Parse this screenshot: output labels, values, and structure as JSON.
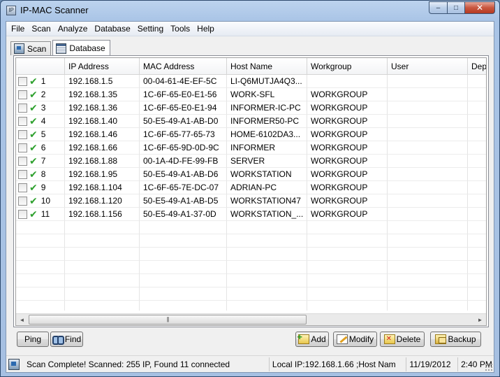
{
  "window": {
    "title": "IP-MAC Scanner",
    "minimize": "‒",
    "maximize": "□",
    "close": "✕"
  },
  "menu": [
    "File",
    "Scan",
    "Analyze",
    "Database",
    "Setting",
    "Tools",
    "Help"
  ],
  "tabs": [
    {
      "label": "Scan",
      "active": false
    },
    {
      "label": "Database",
      "active": true
    }
  ],
  "table": {
    "columns": [
      "",
      "IP Address",
      "MAC Address",
      "Host Name",
      "Workgroup",
      "User",
      "Dep"
    ],
    "rows": [
      {
        "id": "1",
        "ip": "192.168.1.5",
        "mac": "00-04-61-4E-EF-5C",
        "host": "LI-Q6MUTJA4Q3...",
        "workgroup": ""
      },
      {
        "id": "2",
        "ip": "192.168.1.35",
        "mac": "1C-6F-65-E0-E1-56",
        "host": "WORK-SFL",
        "workgroup": "WORKGROUP"
      },
      {
        "id": "3",
        "ip": "192.168.1.36",
        "mac": "1C-6F-65-E0-E1-94",
        "host": "INFORMER-IC-PC",
        "workgroup": "WORKGROUP"
      },
      {
        "id": "4",
        "ip": "192.168.1.40",
        "mac": "50-E5-49-A1-AB-D0",
        "host": "INFORMER50-PC",
        "workgroup": "WORKGROUP"
      },
      {
        "id": "5",
        "ip": "192.168.1.46",
        "mac": "1C-6F-65-77-65-73",
        "host": "HOME-6102DA3...",
        "workgroup": "WORKGROUP"
      },
      {
        "id": "6",
        "ip": "192.168.1.66",
        "mac": "1C-6F-65-9D-0D-9C",
        "host": "INFORMER",
        "workgroup": "WORKGROUP"
      },
      {
        "id": "7",
        "ip": "192.168.1.88",
        "mac": "00-1A-4D-FE-99-FB",
        "host": "SERVER",
        "workgroup": "WORKGROUP"
      },
      {
        "id": "8",
        "ip": "192.168.1.95",
        "mac": "50-E5-49-A1-AB-D6",
        "host": "WORKSTATION",
        "workgroup": "WORKGROUP"
      },
      {
        "id": "9",
        "ip": "192.168.1.104",
        "mac": "1C-6F-65-7E-DC-07",
        "host": "ADRIAN-PC",
        "workgroup": "WORKGROUP"
      },
      {
        "id": "10",
        "ip": "192.168.1.120",
        "mac": "50-E5-49-A1-AB-D5",
        "host": "WORKSTATION47",
        "workgroup": "WORKGROUP"
      },
      {
        "id": "11",
        "ip": "192.168.1.156",
        "mac": "50-E5-49-A1-37-0D",
        "host": "WORKSTATION_...",
        "workgroup": "WORKGROUP"
      }
    ]
  },
  "scrollbar": {
    "left": "◄",
    "right": "►",
    "grip": "|||"
  },
  "buttons": {
    "ping": "Ping",
    "find": "Find",
    "add": "Add",
    "modify": "Modify",
    "delete": "Delete",
    "backup": "Backup"
  },
  "status": {
    "message": "Scan Complete! Scanned: 255 IP, Found 11 connected",
    "local": "Local IP:192.168.1.66 ;Host Nam",
    "date": "11/19/2012",
    "time": "2:40 PM"
  }
}
